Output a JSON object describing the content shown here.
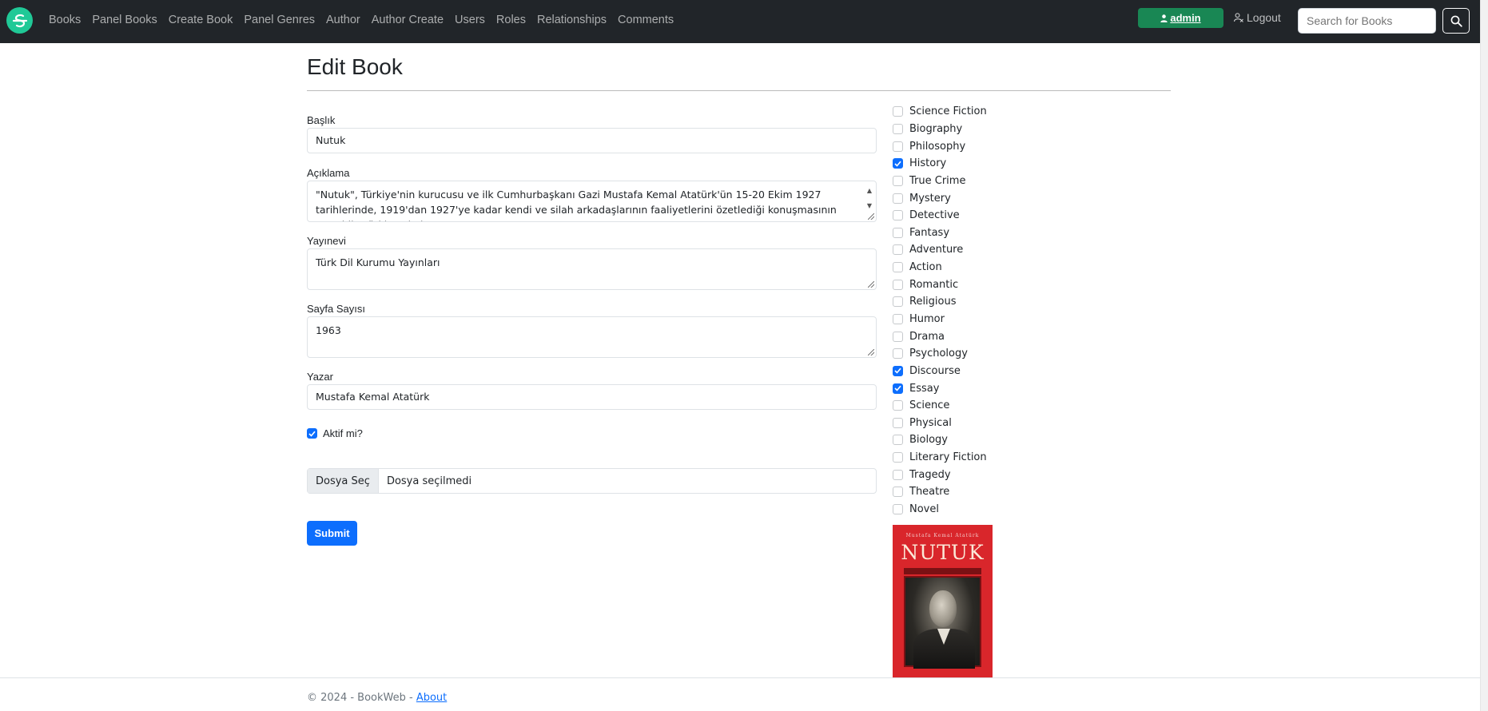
{
  "nav": {
    "links": [
      "Books",
      "Panel Books",
      "Create Book",
      "Panel Genres",
      "Author",
      "Author Create",
      "Users",
      "Roles",
      "Relationships",
      "Comments"
    ],
    "admin_label": "admin",
    "logout_label": "Logout",
    "search_placeholder": "Search for Books"
  },
  "page": {
    "title": "Edit Book"
  },
  "form": {
    "title_label": "Başlık",
    "title_value": "Nutuk",
    "description_label": "Açıklama",
    "description_value": "\"Nutuk\", Türkiye'nin kurucusu ve ilk Cumhurbaşkanı Gazi Mustafa Kemal Atatürk'ün 15-20 Ekim 1927 tarihlerinde, 1919'dan 1927'ye kadar kendi ve silah arkadaşlarının faaliyetlerini özetlediği konuşmasının metnidir. Türkiye'nin bu",
    "publisher_label": "Yayınevi",
    "publisher_value": "Türk Dil Kurumu Yayınları",
    "pages_label": "Sayfa Sayısı",
    "pages_value": "1963",
    "author_label": "Yazar",
    "author_value": "Mustafa Kemal Atatürk",
    "active_label": "Aktif mi?",
    "active_checked": true,
    "file_button_label": "Dosya Seç",
    "file_status": "Dosya seçilmedi",
    "submit_label": "Submit"
  },
  "genres": [
    {
      "name": "Science Fiction",
      "checked": false
    },
    {
      "name": "Biography",
      "checked": false
    },
    {
      "name": "Philosophy",
      "checked": false
    },
    {
      "name": "History",
      "checked": true
    },
    {
      "name": "True Crime",
      "checked": false
    },
    {
      "name": "Mystery",
      "checked": false
    },
    {
      "name": "Detective",
      "checked": false
    },
    {
      "name": "Fantasy",
      "checked": false
    },
    {
      "name": "Adventure",
      "checked": false
    },
    {
      "name": "Action",
      "checked": false
    },
    {
      "name": "Romantic",
      "checked": false
    },
    {
      "name": "Religious",
      "checked": false
    },
    {
      "name": "Humor",
      "checked": false
    },
    {
      "name": "Drama",
      "checked": false
    },
    {
      "name": "Psychology",
      "checked": false
    },
    {
      "name": "Discourse",
      "checked": true
    },
    {
      "name": "Essay",
      "checked": true
    },
    {
      "name": "Science",
      "checked": false
    },
    {
      "name": "Physical",
      "checked": false
    },
    {
      "name": "Biology",
      "checked": false
    },
    {
      "name": "Literary Fiction",
      "checked": false
    },
    {
      "name": "Tragedy",
      "checked": false
    },
    {
      "name": "Theatre",
      "checked": false
    },
    {
      "name": "Novel",
      "checked": false
    }
  ],
  "cover": {
    "author_line": "Mustafa Kemal Atatürk",
    "title": "NUTUK"
  },
  "footer": {
    "text": "© 2024 - BookWeb - ",
    "about_label": "About"
  },
  "colors": {
    "navbar": "#212529",
    "admin_button": "#198754",
    "primary": "#0d6efd",
    "cover_red": "#d9262b"
  }
}
